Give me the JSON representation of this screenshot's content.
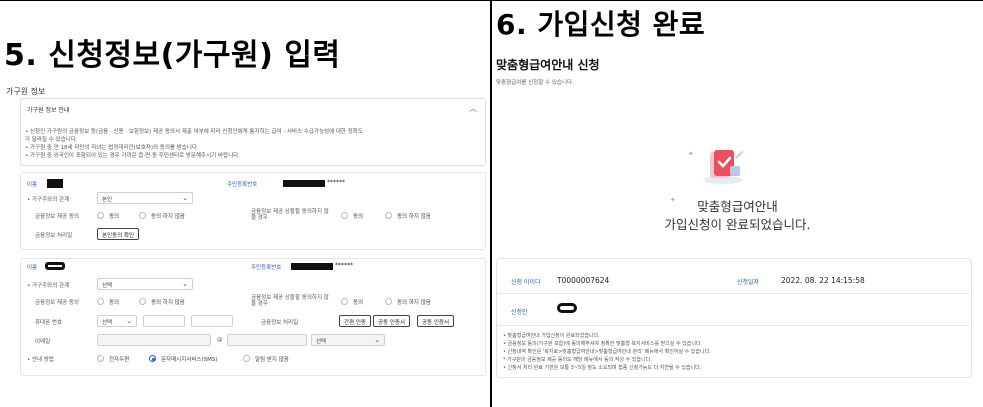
{
  "left": {
    "step_title": "5. 신청정보(가구원) 입력",
    "section_label": "가구원 정보",
    "notice": {
      "title": "가구원 정보 안내",
      "lines": [
        "• 신청인 가구원의 금융정보 등(금융 · 신용 · 보험정보) 제공 동의서 제출 여부에 따라 신청인에게 통지하는 급여 · 서비스 수급가능성에 대한 정확도",
        "  가 달라질 수 있습니다.",
        "• 가구원 중 만 18세 미만의 자녀는 법정대리인(보호자)의 동의를 받습니다.",
        "• 가구원 중 외국인이 포함되어 있는 경우 가까운 읍·면·동 주민센터로 방문해주시기 바랍니다."
      ]
    },
    "card1": {
      "name_label": "이름",
      "rrn_label": "주민등록번호",
      "rrn_mask": "******",
      "relation_label": "• 가구주와의 관계",
      "relation_value": "본인",
      "fin_consent_label": "금융정보 제공 동의",
      "agree": "동의",
      "disagree": "동의 하지 않음",
      "credit_consent_label": "금융정보 제공 상황할 동의하지 않을 경우",
      "agree2": "동의",
      "disagree2": "동의 하지 않음",
      "fin_process_label": "금융정보 처리일",
      "verify_button": "본인동의 확인"
    },
    "card2": {
      "name_label": "이름",
      "rrn_label": "주민등록번호",
      "rrn_mask": "******",
      "relation_label": "• 가구주와의 관계",
      "relation_value": "선택",
      "fin_consent_label": "금융정보 제공 동의",
      "agree": "동의",
      "disagree": "동의 하지 않음",
      "credit_consent_label": "금융정보 제공 상황할 동의하지 않을 경우",
      "agree2": "동의",
      "disagree2": "동의 하지 않음",
      "phone_label": "휴대폰 번호",
      "phone_select": "선택",
      "fin_process_label": "금융정보 처리일",
      "btn_simple": "간편 인증",
      "btn_cert": "공동 인증서",
      "btn_joint": "공동 인증서",
      "email_label": "이메일",
      "email_at": "@",
      "email_select": "선택",
      "notify_label": "• 안내 방법",
      "notify_opt1": "전자우편",
      "notify_opt2": "문자메시지서비스(SMS)",
      "notify_opt3": "알림 받지 않음"
    }
  },
  "right": {
    "step_title": "6. 가입신청 완료",
    "page_head": "맞춤형급여안내 신청",
    "page_sub": "맞춤형급여를 신청할 수 있습니다.",
    "done_line1": "맞춤형급여안내",
    "done_line2": "가입신청이 완료되었습니다.",
    "result": {
      "apply_id_label": "신청 아이디",
      "apply_id_value": "T0000007624",
      "apply_date_label": "신청일자",
      "apply_date_value": "2022. 08. 22 14:15:58",
      "applicant_label": "신청인",
      "notes": [
        "• 맞춤형급여안내 가입신청이 완료되었습니다.",
        "• 금융정보 동의(가구원 포함)에 동의해주셔야 정확한 맞춤형 복지서비스를 받으실 수 있습니다.",
        "• 신청내역 확인은 '복지로>맞춤형급여안내>맞춤형급여안내 관리' 메뉴에서 확인하실 수 있습니다.",
        "  * 가구원의 금융정보 제공 동의도 해당 메뉴에서 동의 작성 수 있습니다.",
        "• 신청서 처리 완료 기한은 보통 3~5일 정도 소요되며 접종 신청가능도 더 지연될 수 있습니다."
      ]
    }
  },
  "colors": {
    "accent_blue": "#2f5fbf",
    "illus_red": "#e8505b",
    "illus_light": "#f6c7c9"
  },
  "icons": {
    "illustration": "document-check-icon",
    "chevron": "chevron-down-icon",
    "collapse": "chevron-up-icon"
  }
}
